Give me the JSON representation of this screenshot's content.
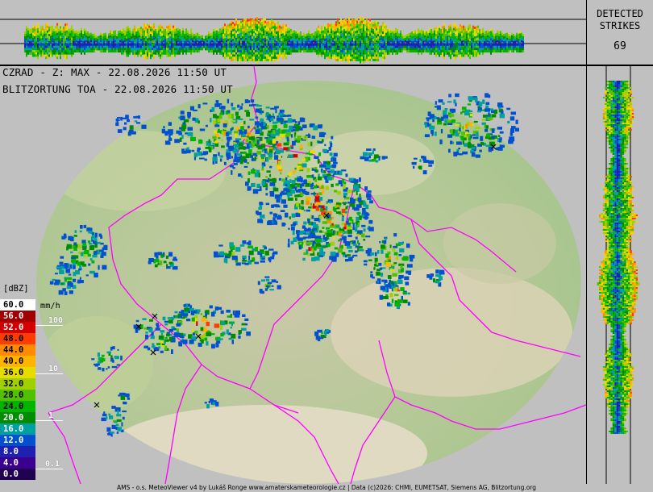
{
  "header": {
    "line1": "CZRAD - Z: MAX - 22.08.2026 11:50 UT",
    "line2": "BLITZORTUNG TOA - 22.08.2026 11:50 UT"
  },
  "strikes": {
    "title": "DETECTED\nSTRIKES",
    "count": "69"
  },
  "legend": {
    "unit": "[dBZ]",
    "rain_unit": "mm/h",
    "levels": [
      {
        "value": "60.0",
        "color": "#ffffff",
        "text": "#000000"
      },
      {
        "value": "56.0",
        "color": "#a00000",
        "text": "#ffffff"
      },
      {
        "value": "52.0",
        "color": "#d40000",
        "text": "#ffffff"
      },
      {
        "value": "48.0",
        "color": "#ff3c00",
        "text": "#000000"
      },
      {
        "value": "44.0",
        "color": "#ff8c00",
        "text": "#000000"
      },
      {
        "value": "40.0",
        "color": "#ffb400",
        "text": "#000000"
      },
      {
        "value": "36.0",
        "color": "#e6dc00",
        "text": "#000000"
      },
      {
        "value": "32.0",
        "color": "#a0d000",
        "text": "#000000"
      },
      {
        "value": "28.0",
        "color": "#50c000",
        "text": "#000000"
      },
      {
        "value": "24.0",
        "color": "#00b400",
        "text": "#000000"
      },
      {
        "value": "20.0",
        "color": "#008c00",
        "text": "#ffffff"
      },
      {
        "value": "16.0",
        "color": "#00a0a0",
        "text": "#ffffff"
      },
      {
        "value": "12.0",
        "color": "#0050d0",
        "text": "#ffffff"
      },
      {
        "value": "8.0",
        "color": "#2020b0",
        "text": "#ffffff"
      },
      {
        "value": "4.0",
        "color": "#3c0090",
        "text": "#ffffff"
      },
      {
        "value": "0.0",
        "color": "#200050",
        "text": "#ffffff"
      }
    ],
    "rain_rates": [
      "100",
      "10",
      "1",
      "0.1"
    ]
  },
  "footer": "AMS - o.s. MeteoViewer v4 by Lukáš Ronge www.amaterskameteorologie.cz | Data (c)2026: CHMI, EUMETSAT, Siemens AG, Blitzortung.org",
  "colors": {
    "background": "#c0c0c0",
    "border": "#ff00ff",
    "terrain_low": "#8fbf7a",
    "terrain_high": "#e8dfc8"
  }
}
